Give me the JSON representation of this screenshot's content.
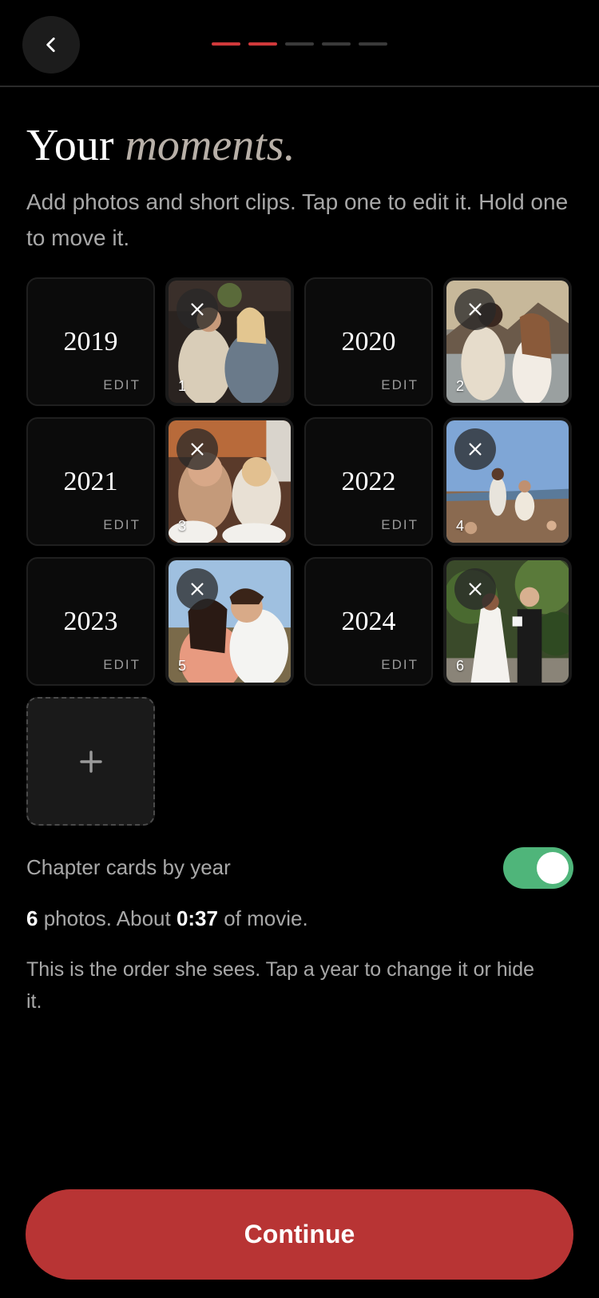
{
  "header": {
    "back_icon": "chevron-left-icon",
    "progress_steps": 5,
    "progress_current": 2,
    "accent_color": "#d0393b"
  },
  "title": {
    "main": "Your",
    "accent": "moments."
  },
  "subtitle": "Add photos and short clips. Tap one to edit it. Hold one to move it.",
  "grid": {
    "chapters": [
      {
        "year": "2019",
        "edit_label": "EDIT"
      },
      {
        "year": "2020",
        "edit_label": "EDIT"
      },
      {
        "year": "2021",
        "edit_label": "EDIT"
      },
      {
        "year": "2022",
        "edit_label": "EDIT"
      },
      {
        "year": "2023",
        "edit_label": "EDIT"
      },
      {
        "year": "2024",
        "edit_label": "EDIT"
      }
    ],
    "photos": [
      {
        "number": "1",
        "remove_icon": "close-icon"
      },
      {
        "number": "2",
        "remove_icon": "close-icon"
      },
      {
        "number": "3",
        "remove_icon": "close-icon"
      },
      {
        "number": "4",
        "remove_icon": "close-icon"
      },
      {
        "number": "5",
        "remove_icon": "close-icon"
      },
      {
        "number": "6",
        "remove_icon": "close-icon"
      }
    ],
    "add_icon": "plus-icon"
  },
  "chapter_toggle": {
    "label": "Chapter cards by year",
    "enabled": true,
    "color": "#4fb57a"
  },
  "stats": {
    "photo_count": "6",
    "photos_text": " photos. About ",
    "duration": "0:37",
    "duration_text": " of movie."
  },
  "note": "This is the order she sees. Tap a year to change it or hide it.",
  "continue_button": {
    "label": "Continue",
    "color": "#b83434"
  }
}
